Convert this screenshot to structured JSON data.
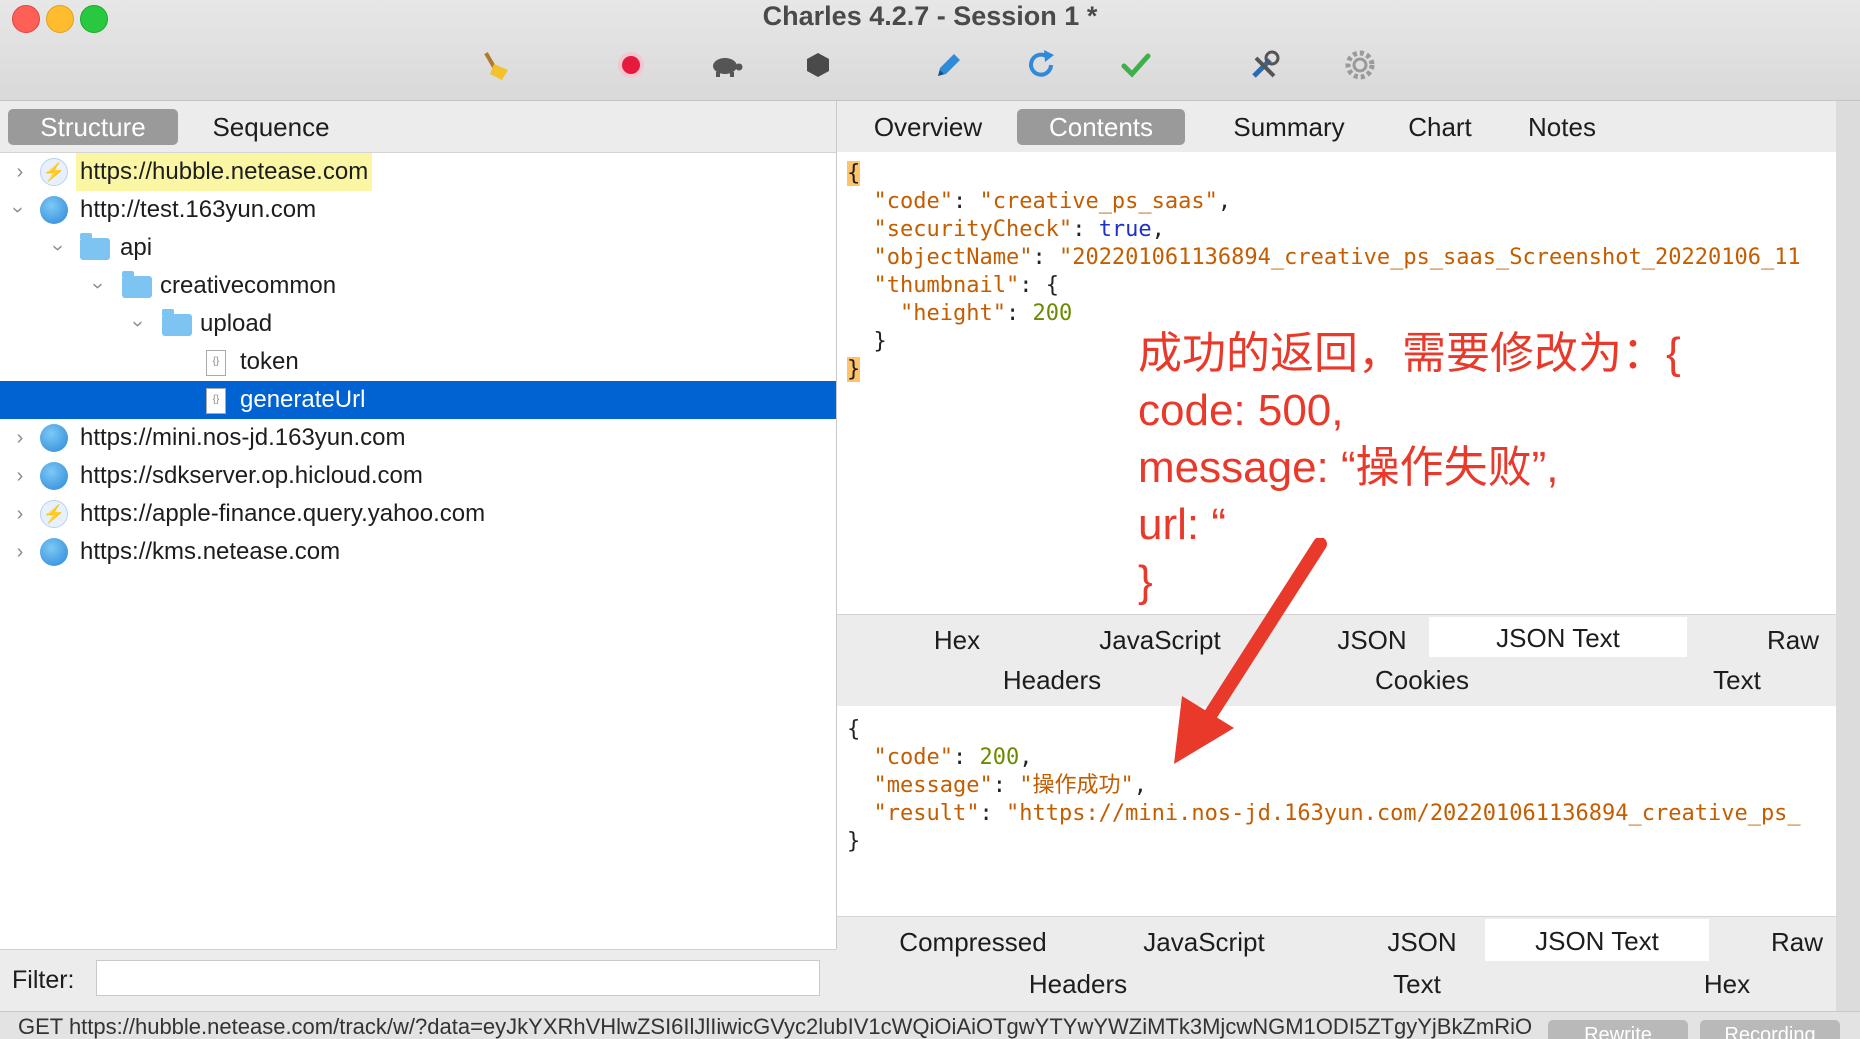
{
  "window": {
    "title": "Charles 4.2.7 - Session 1 *"
  },
  "toolbar": {
    "tools": [
      "broom-icon",
      "record-icon",
      "throttle-turtle-icon",
      "breakpoint-hexagon-icon",
      "compose-pen-icon",
      "repeat-icon",
      "validate-check-icon",
      "tools-icon",
      "settings-gear-icon"
    ]
  },
  "left": {
    "tabs": [
      "Structure",
      "Sequence"
    ],
    "active_tab": "Structure",
    "tree": [
      {
        "label": "https://hubble.netease.com",
        "icon": "bolt-icon"
      },
      {
        "label": "http://test.163yun.com",
        "icon": "globe-icon"
      },
      {
        "label": "api",
        "icon": "folder-icon"
      },
      {
        "label": "creativecommon",
        "icon": "folder-icon"
      },
      {
        "label": "upload",
        "icon": "folder-icon"
      },
      {
        "label": "token",
        "icon": "json-file-icon"
      },
      {
        "label": "generateUrl",
        "icon": "json-file-icon"
      },
      {
        "label": "https://mini.nos-jd.163yun.com",
        "icon": "globe-icon"
      },
      {
        "label": "https://sdkserver.op.hicloud.com",
        "icon": "globe-icon"
      },
      {
        "label": "https://apple-finance.query.yahoo.com",
        "icon": "bolt-icon"
      },
      {
        "label": "https://kms.netease.com",
        "icon": "globe-icon"
      }
    ],
    "filter_label": "Filter:",
    "filter_value": ""
  },
  "right": {
    "tabs": [
      "Overview",
      "Contents",
      "Summary",
      "Chart",
      "Notes"
    ],
    "active_tab": "Contents",
    "request_json": {
      "open": "{",
      "code_key": "\"code\"",
      "code_val": "\"creative_ps_saas\"",
      "security_key": "\"securityCheck\"",
      "security_val": "true",
      "object_key": "\"objectName\"",
      "object_val": "\"202201061136894_creative_ps_saas_Screenshot_20220106_11",
      "thumb_key": "\"thumbnail\"",
      "height_key": "\"height\"",
      "height_val": "200",
      "inner_close": "}",
      "close": "}"
    },
    "request_tabs": {
      "row1": [
        "Hex",
        "JavaScript",
        "JSON",
        "JSON Text",
        "Raw"
      ],
      "row2": [
        "Headers",
        "Cookies",
        "Text"
      ],
      "active": "JSON Text"
    },
    "response_json": {
      "open": "{",
      "code_key": "\"code\"",
      "code_val": "200",
      "message_key": "\"message\"",
      "message_val": "\"操作成功\"",
      "result_key": "\"result\"",
      "result_val": "\"https://mini.nos-jd.163yun.com/202201061136894_creative_ps_",
      "close": "}"
    },
    "response_tabs": {
      "row1": [
        "Compressed",
        "JavaScript",
        "JSON",
        "JSON Text",
        "Raw"
      ],
      "row2": [
        "Headers",
        "Text",
        "Hex"
      ],
      "active": "JSON Text"
    }
  },
  "annotation": {
    "lines": [
      "成功的返回，需要修改为：{",
      "code: 500,",
      "message: “操作失败”,",
      "url: “",
      "}"
    ],
    "color": "#e8392a"
  },
  "status": {
    "text": "GET https://hubble.netease.com/track/w/?data=eyJkYXRhVHlwZSI6IlJlIiwicGVyc2lubIV1cWQiOiAiOTgwYTYwYWZiMTk3MjcwNGM1ODI5ZTgyYjBkZmRiO",
    "rewrite": "Rewrite",
    "recording": "Recording"
  }
}
